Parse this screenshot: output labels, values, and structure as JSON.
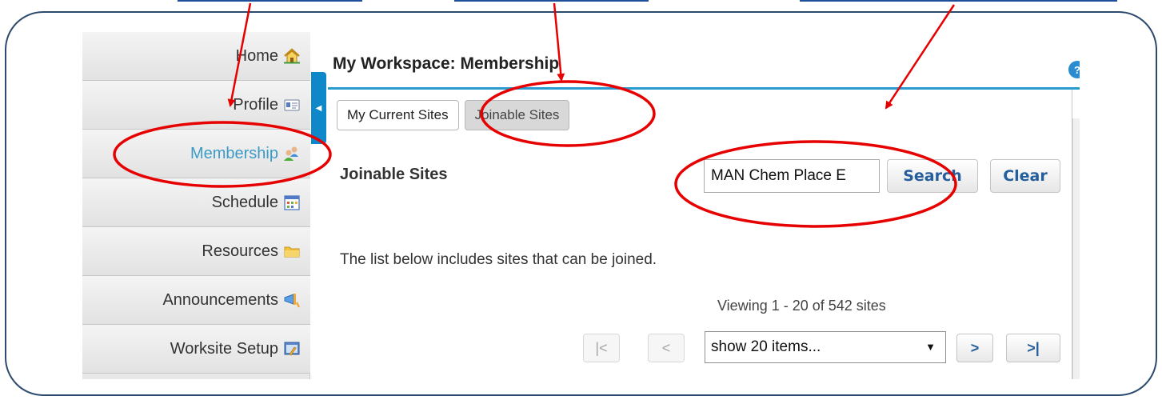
{
  "sidebar": {
    "items": [
      {
        "label": "Home",
        "icon": "home-icon",
        "active": false
      },
      {
        "label": "Profile",
        "icon": "profile-card-icon",
        "active": false
      },
      {
        "label": "Membership",
        "icon": "membership-people-icon",
        "active": true
      },
      {
        "label": "Schedule",
        "icon": "calendar-icon",
        "active": false
      },
      {
        "label": "Resources",
        "icon": "folder-icon",
        "active": false
      },
      {
        "label": "Announcements",
        "icon": "megaphone-icon",
        "active": false
      },
      {
        "label": "Worksite Setup",
        "icon": "worksite-setup-icon",
        "active": false
      }
    ],
    "toggle_icon": "chevron-left-icon"
  },
  "header": {
    "title": "My Workspace: Membership",
    "help_icon": "help-icon"
  },
  "tabs": [
    {
      "label": "My Current Sites",
      "active": false
    },
    {
      "label": "Joinable Sites",
      "active": true
    }
  ],
  "content": {
    "section_title": "Joinable Sites",
    "search": {
      "value": "MAN Chem Place E",
      "button": "Search",
      "clear": "Clear"
    },
    "info_text": "The list below includes sites that can be joined.",
    "viewing_text": "Viewing 1 - 20 of 542 sites",
    "pager": {
      "first": "|<",
      "prev": "<",
      "next": ">",
      "last": ">|",
      "page_size": "show 20 items..."
    }
  },
  "colors": {
    "accent": "#2a9bd1",
    "annotation": "#e60000",
    "frame": "#2c4a6e",
    "link": "#1e4f9a"
  }
}
